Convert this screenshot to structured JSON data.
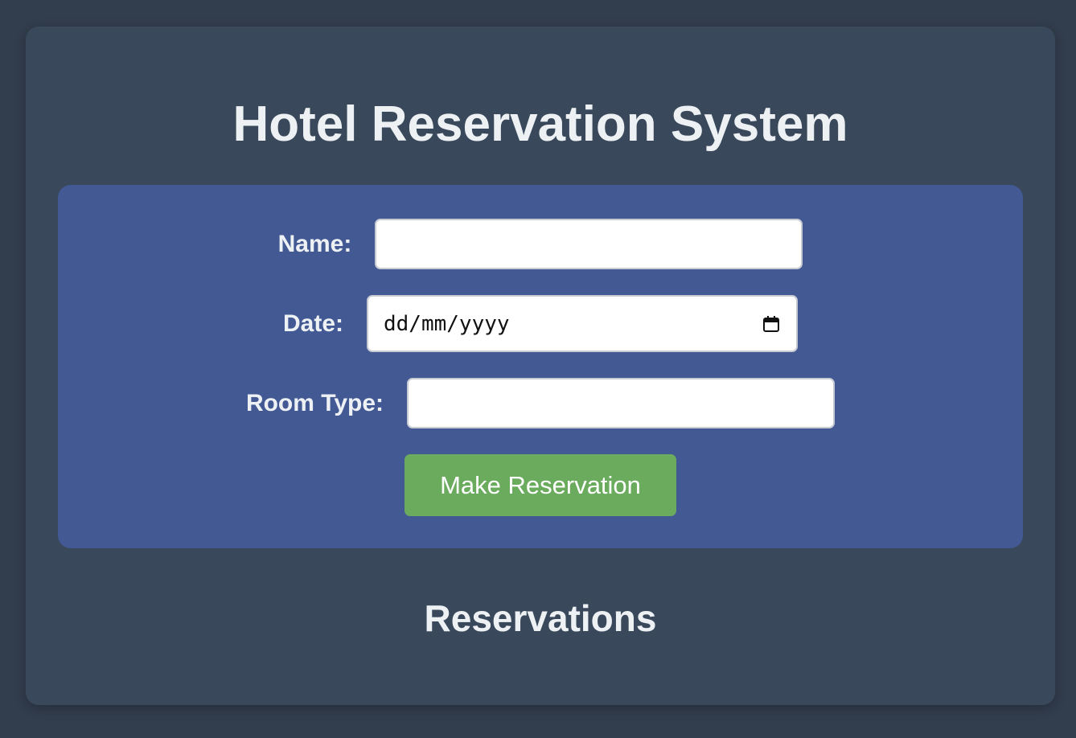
{
  "page": {
    "title": "Hotel Reservation System"
  },
  "form": {
    "name_label": "Name:",
    "name_value": "",
    "date_label": "Date:",
    "date_placeholder": "dd/mm/yyyy",
    "room_type_label": "Room Type:",
    "room_type_value": "",
    "submit_label": "Make Reservation"
  },
  "reservations": {
    "title": "Reservations",
    "items": []
  },
  "colors": {
    "background": "#323d4d",
    "card": "#39495b",
    "form_panel": "#435994",
    "submit_button": "#6aab5e",
    "text": "#eef1f4"
  },
  "icons": {
    "date_picker": "calendar-icon"
  }
}
